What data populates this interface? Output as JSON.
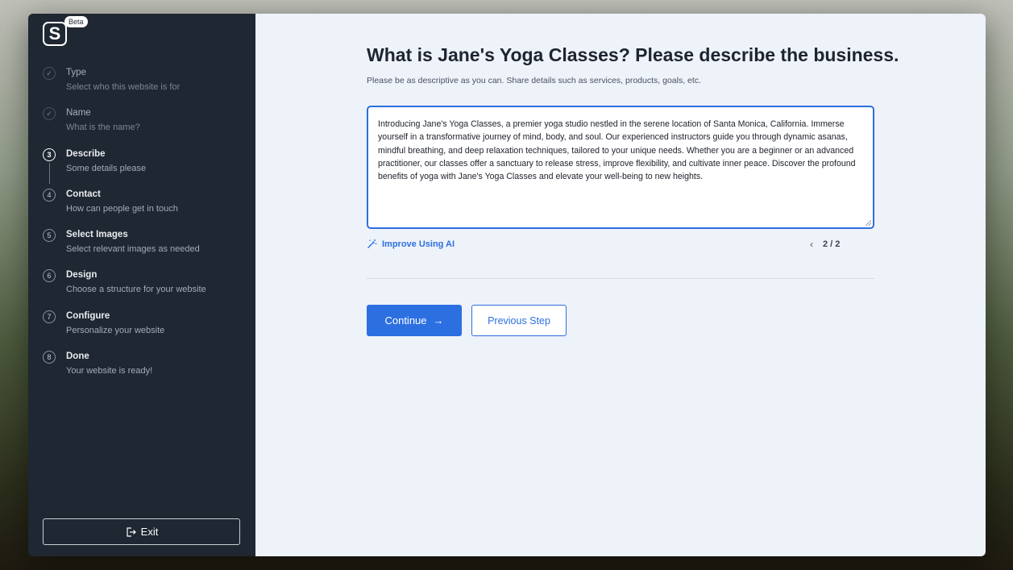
{
  "sidebar": {
    "logo_letter": "S",
    "beta_label": "Beta",
    "steps": [
      {
        "marker": "✓",
        "title": "Type",
        "subtitle": "Select who this website is for"
      },
      {
        "marker": "✓",
        "title": "Name",
        "subtitle": "What is the name?"
      },
      {
        "marker": "3",
        "title": "Describe",
        "subtitle": "Some details please"
      },
      {
        "marker": "4",
        "title": "Contact",
        "subtitle": "How can people get in touch"
      },
      {
        "marker": "5",
        "title": "Select Images",
        "subtitle": "Select relevant images as needed"
      },
      {
        "marker": "6",
        "title": "Design",
        "subtitle": "Choose a structure for your website"
      },
      {
        "marker": "7",
        "title": "Configure",
        "subtitle": "Personalize your website"
      },
      {
        "marker": "8",
        "title": "Done",
        "subtitle": "Your website is ready!"
      }
    ],
    "exit_label": "Exit"
  },
  "main": {
    "title": "What is Jane's Yoga Classes? Please describe the business.",
    "subtitle": "Please be as descriptive as you can. Share details such as services, products, goals, etc.",
    "description_text": "Introducing Jane's Yoga Classes, a premier yoga studio nestled in the serene location of Santa Monica, California. Immerse yourself in a transformative journey of mind, body, and soul. Our experienced instructors guide you through dynamic asanas, mindful breathing, and deep relaxation techniques, tailored to your unique needs. Whether you are a beginner or an advanced practitioner, our classes offer a sanctuary to release stress, improve flexibility, and cultivate inner peace. Discover the profound benefits of yoga with Jane's Yoga Classes and elevate your well-being to new heights.",
    "improve_label": "Improve Using AI",
    "pager_prev": "‹",
    "pager_text": "2 / 2",
    "continue_label": "Continue",
    "continue_arrow": "→",
    "previous_label": "Previous Step"
  },
  "colors": {
    "accent": "#2c6fe0",
    "sidebar_bg": "#1f2732",
    "main_bg": "#eef2f9"
  }
}
